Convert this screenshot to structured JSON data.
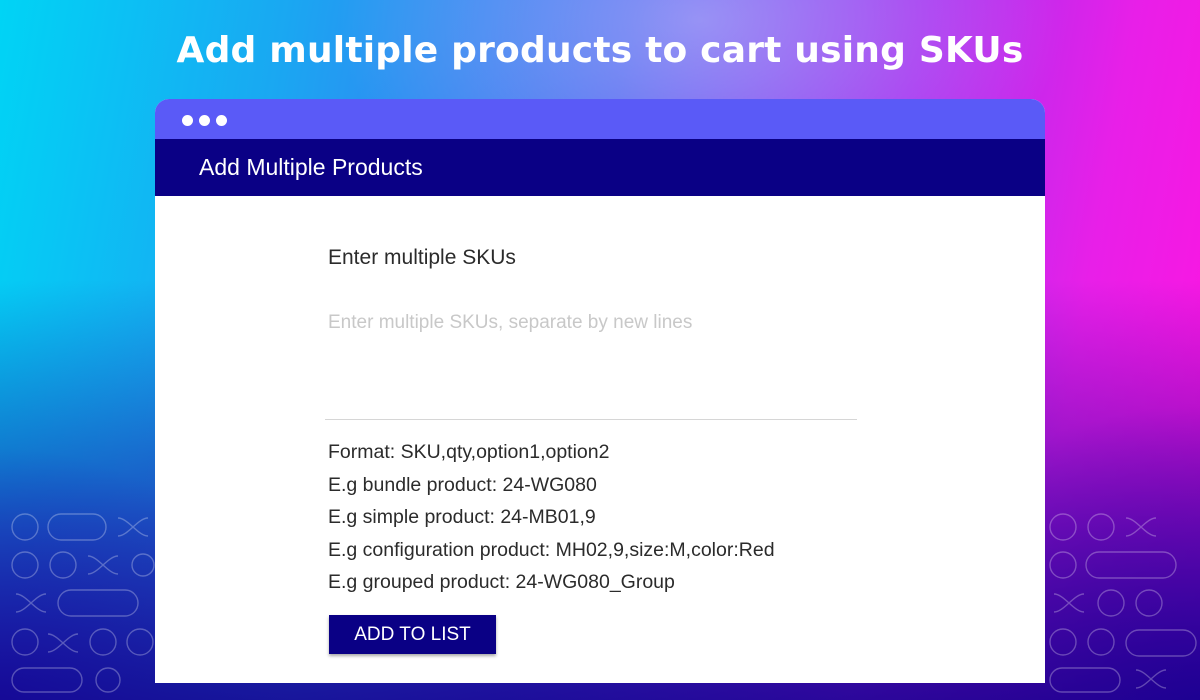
{
  "headline": "Add multiple products to cart using SKUs",
  "window": {
    "header_title": "Add Multiple Products"
  },
  "form": {
    "label": "Enter multiple SKUs",
    "input_placeholder": "Enter multiple SKUs, separate by new lines",
    "input_value": "",
    "help_lines": [
      "Format: SKU,qty,option1,option2",
      "E.g bundle product: 24-WG080",
      "E.g simple product: 24-MB01,9",
      "E.g configuration product: MH02,9,size:M,color:Red",
      "E.g grouped product: 24-WG080_Group"
    ],
    "button_label": "ADD TO LIST"
  },
  "colors": {
    "header_bg": "#0a0085",
    "titlebar_bg": "#5a5af7",
    "button_bg": "#0a0085",
    "placeholder": "#c8c8c8"
  },
  "icons": {
    "window_controls": "three-dots-icon",
    "decoration": "loop-pattern-icon"
  }
}
